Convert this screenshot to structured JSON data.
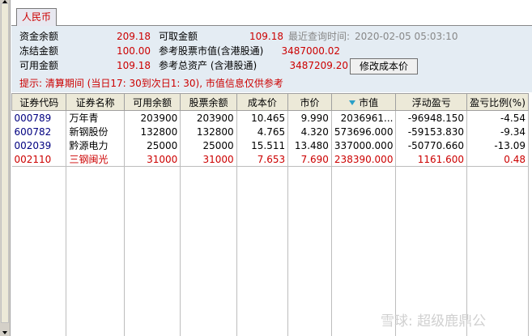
{
  "tab": {
    "label": "人民币"
  },
  "summary": {
    "zijin_label": "资金余额",
    "zijin_value": "209.18",
    "keqv_label": "可取金额",
    "keqv_value": "109.18",
    "query_label": "最近查询时间:",
    "query_value": "2020-02-05 05:03:10",
    "dongjie_label": "冻结金额",
    "dongjie_value": "100.00",
    "shizhi_label": "参考股票市值(含港股通)",
    "shizhi_value": "3487000.02",
    "keyong_label": "可用金额",
    "keyong_value": "109.18",
    "zongzichan_label": "参考总资产 (含港股通)",
    "zongzichan_value": "3487209.20",
    "cost_button": "修改成本价",
    "tip": "提示: 清算期间 (当日17: 30到次日1: 30), 市值信息仅供参考"
  },
  "table": {
    "headers": [
      "证券代码",
      "证券名称",
      "可用余额",
      "股票余额",
      "成本价",
      "市价",
      "市值",
      "浮动盈亏",
      "盈亏比例(%)"
    ],
    "rows": [
      {
        "code": "000789",
        "name": "万年青",
        "avail": "203900",
        "balance": "203900",
        "cost": "10.465",
        "price": "9.990",
        "value": "2036961...",
        "pnl": "-96948.150",
        "ratio": "-4.54"
      },
      {
        "code": "600782",
        "name": "新钢股份",
        "avail": "132800",
        "balance": "132800",
        "cost": "4.765",
        "price": "4.320",
        "value": "573696.000",
        "pnl": "-59153.830",
        "ratio": "-9.34"
      },
      {
        "code": "002039",
        "name": "黔源电力",
        "avail": "25000",
        "balance": "25000",
        "cost": "15.511",
        "price": "13.480",
        "value": "337000.000",
        "pnl": "-50770.660",
        "ratio": "-13.09"
      },
      {
        "code": "002110",
        "name": "三钢闽光",
        "avail": "31000",
        "balance": "31000",
        "cost": "7.653",
        "price": "7.690",
        "value": "238390.000",
        "pnl": "1161.600",
        "ratio": "0.48"
      }
    ]
  },
  "watermark": "雪球: 超级鹿鼎公",
  "colors": {
    "accent_red": "#cc0000",
    "panel_bg": "#e4ecf3",
    "header_bg": "#ece9d8"
  }
}
